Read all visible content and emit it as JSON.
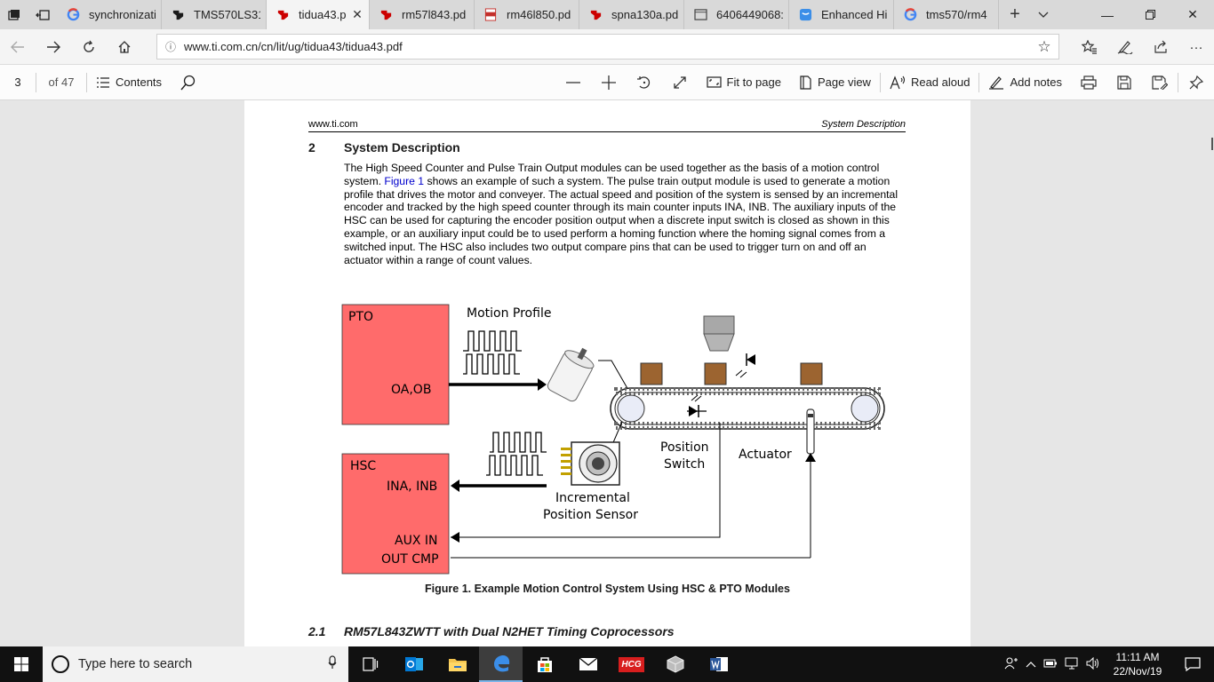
{
  "tabs": [
    {
      "title": "synchronizati",
      "icon": "google-icon",
      "active": false
    },
    {
      "title": "TMS570LS31",
      "icon": "ti-logo-icon",
      "active": false
    },
    {
      "title": "tidua43.p",
      "icon": "ti-logo-icon",
      "active": true
    },
    {
      "title": "rm57l843.pd",
      "icon": "ti-logo-icon",
      "active": false
    },
    {
      "title": "rm46l850.pd",
      "icon": "pdf-icon",
      "active": false
    },
    {
      "title": "spna130a.pd",
      "icon": "ti-logo-icon",
      "active": false
    },
    {
      "title": "6406449068:",
      "icon": "page-icon",
      "active": false
    },
    {
      "title": "Enhanced Hi",
      "icon": "edge-reading-icon",
      "active": false
    },
    {
      "title": "tms570/rm4",
      "icon": "google-icon",
      "active": false
    }
  ],
  "address": {
    "url": "www.ti.com.cn/cn/lit/ug/tidua43/tidua43.pdf"
  },
  "pdf_toolbar": {
    "page": "3",
    "of_pages": "of 47",
    "contents": "Contents",
    "fit_to_page": "Fit to page",
    "page_view": "Page view",
    "read_aloud": "Read aloud",
    "add_notes": "Add notes"
  },
  "document": {
    "header_left": "www.ti.com",
    "header_right": "System Description",
    "section_number": "2",
    "section_title": "System Description",
    "para_before_link": "The High Speed Counter and Pulse Train Output modules can be used together as the basis of a motion control system. ",
    "para_link": "Figure 1",
    "para_after_link": " shows an example of such a system. The pulse train output module is used to generate a motion profile that drives the motor and conveyer. The actual speed and position of the system is sensed by an incremental encoder and tracked by the high speed counter through its main counter inputs INA, INB. The auxiliary inputs of the HSC can be used for capturing the encoder position output when a discrete input switch is closed as shown in this example, or an auxiliary input could be to used perform a homing function where the homing signal comes from a switched input. The HSC also includes two output compare pins that can be used to trigger turn on and off an actuator within a range of count values.",
    "figure": {
      "pto_label": "PTO",
      "oa_ob": "OA,OB",
      "hsc_label": "HSC",
      "ina_inb": "INA, INB",
      "aux_in": "AUX IN",
      "out_cmp": "OUT CMP",
      "motion_profile": "Motion Profile",
      "position_switch_1": "Position",
      "position_switch_2": "Switch",
      "actuator": "Actuator",
      "incremental_1": "Incremental",
      "incremental_2": "Position Sensor",
      "block_color": "#ff6b6b",
      "box_color": "#9c6430"
    },
    "figure_caption": "Figure 1. Example Motion Control System Using HSC & PTO Modules",
    "subsection_number": "2.1",
    "subsection_title": "RM57L843ZWTT with Dual N2HET Timing Coprocessors"
  },
  "taskbar": {
    "search_placeholder": "Type here to search",
    "time": "11:11 AM",
    "date": "22/Nov/19",
    "hcg_label": "HCG"
  }
}
